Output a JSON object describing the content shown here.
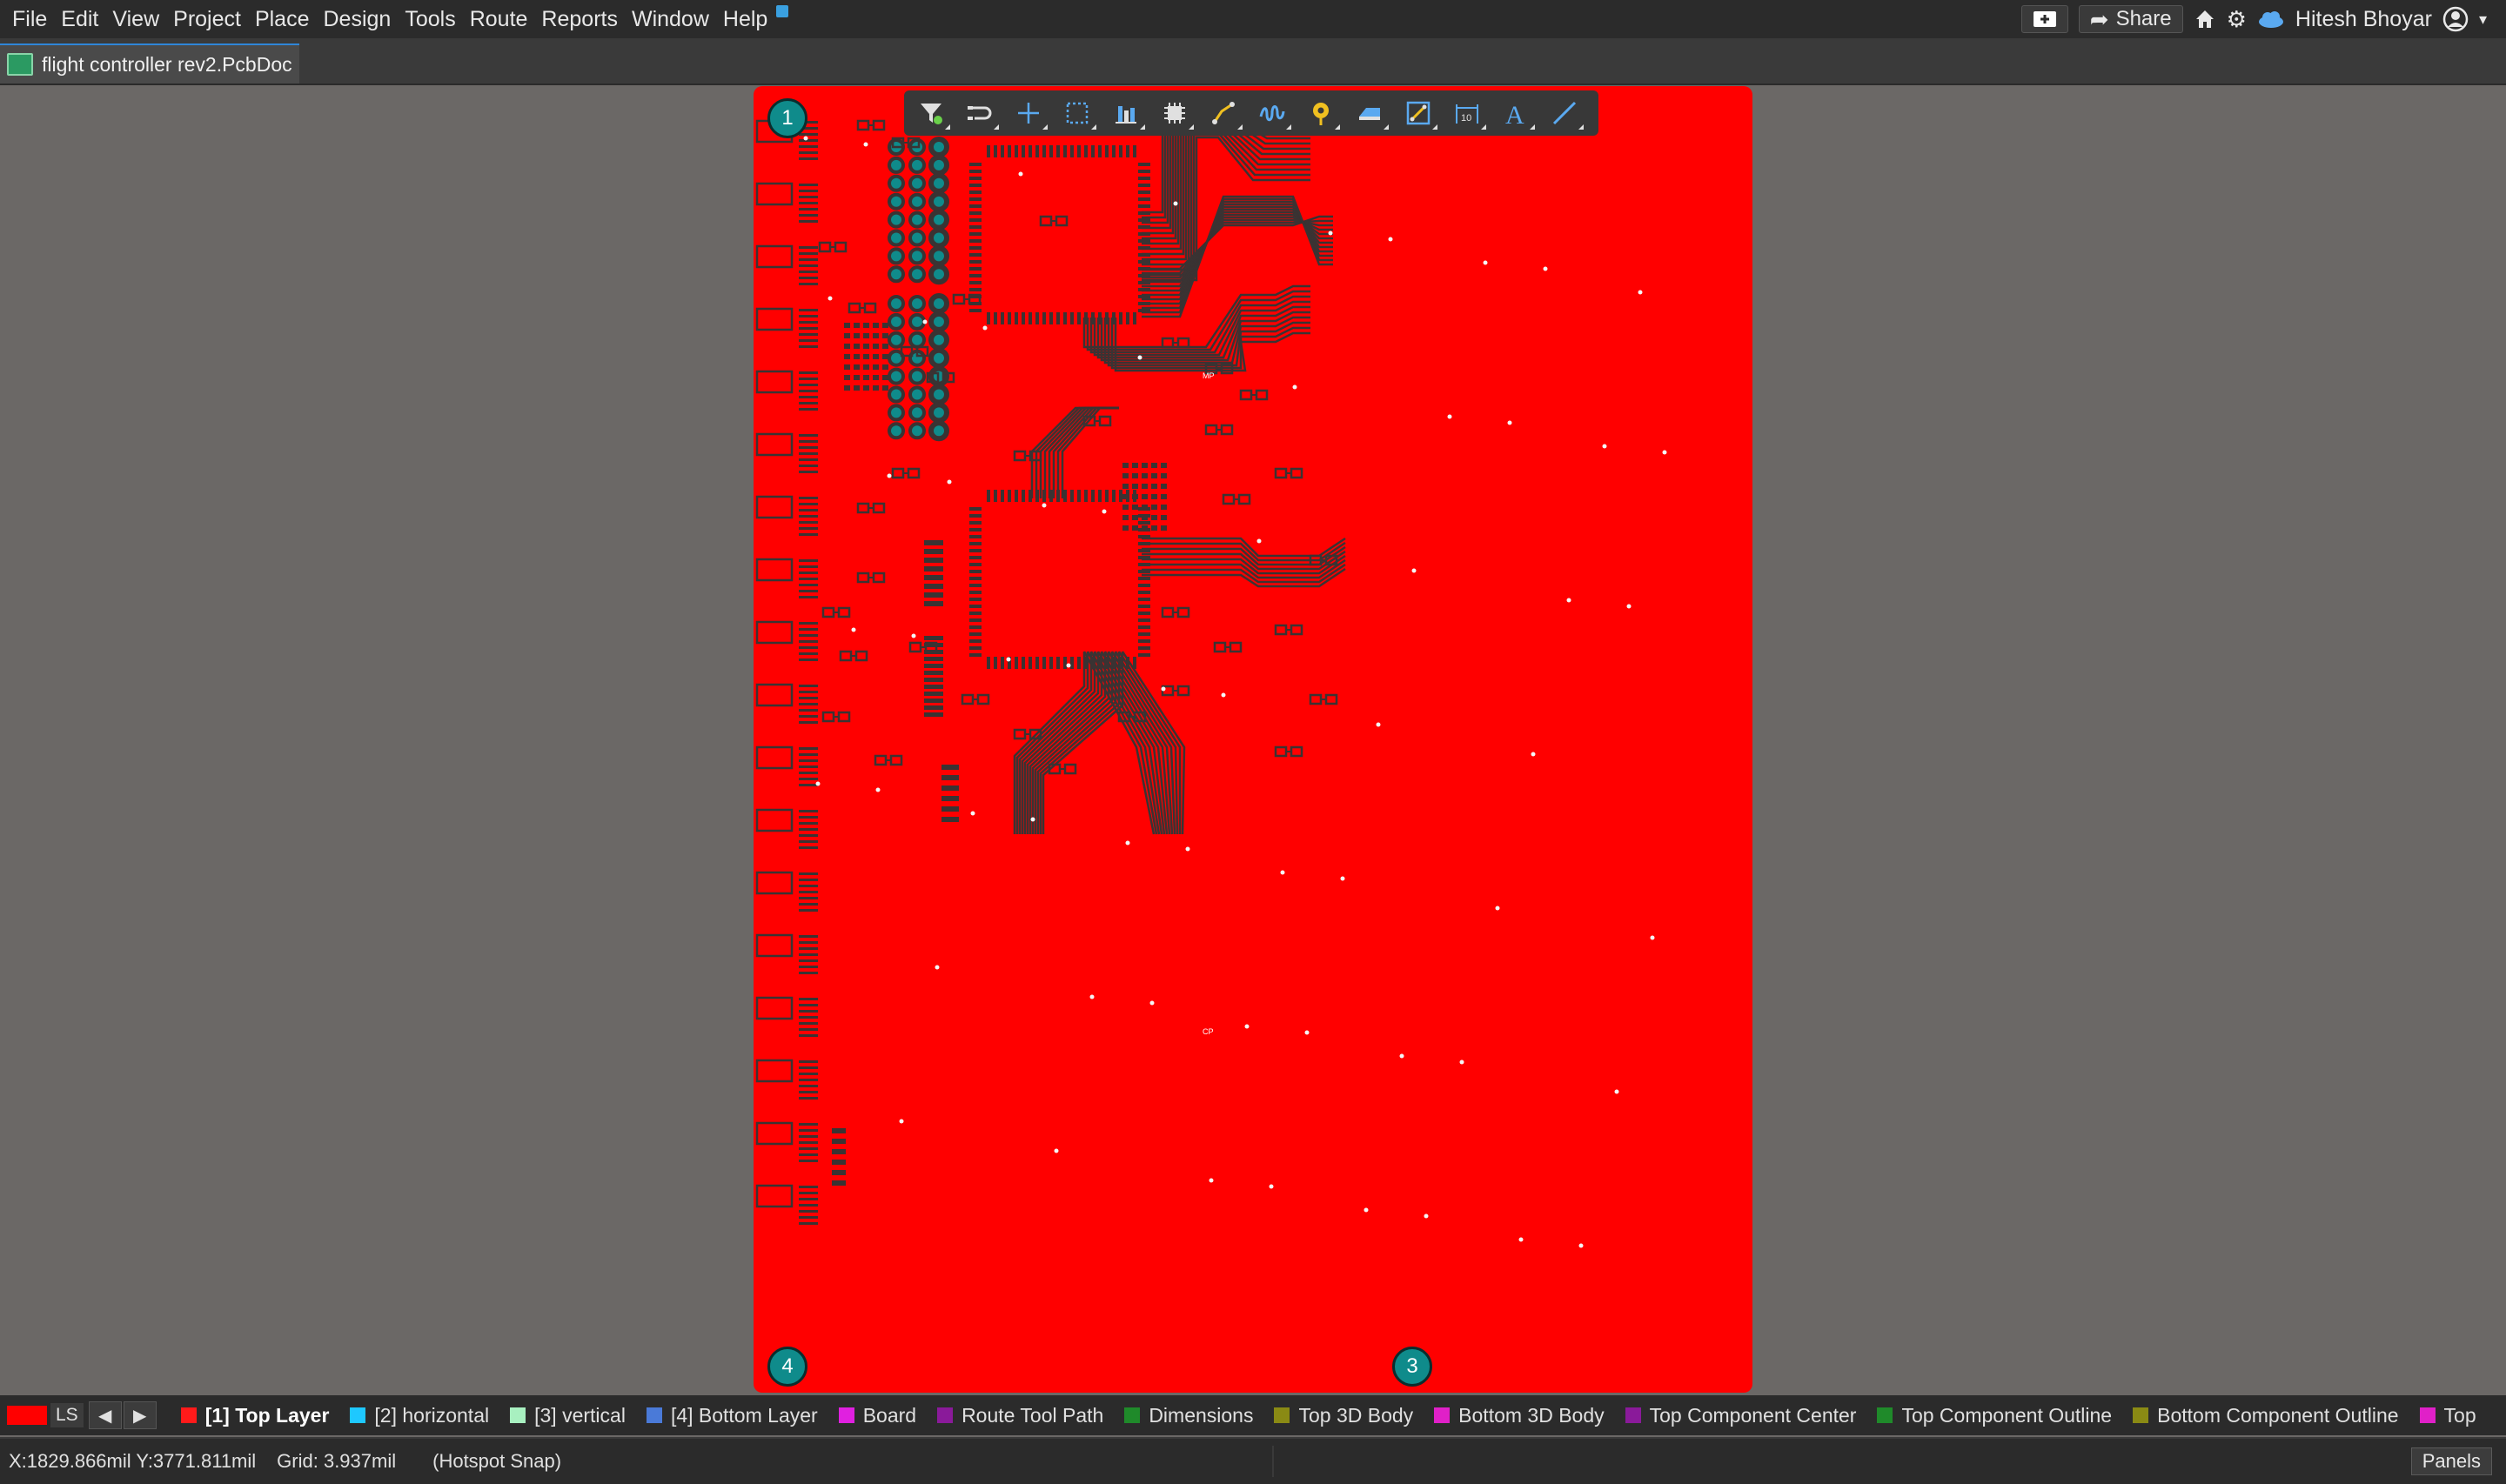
{
  "menubar": {
    "items": [
      "File",
      "Edit",
      "View",
      "Project",
      "Place",
      "Design",
      "Tools",
      "Route",
      "Reports",
      "Window",
      "Help"
    ],
    "share_label": "Share",
    "user_name": "Hitesh Bhoyar"
  },
  "document": {
    "tab_label": "flight controller rev2.PcbDoc"
  },
  "board": {
    "markers": [
      "1",
      "4",
      "3"
    ],
    "chip_labels": [
      "MP",
      "CP"
    ]
  },
  "floating_toolbar": {
    "icons": [
      "filter-icon",
      "interactive-routing-icon",
      "cross-icon",
      "select-rect-icon",
      "align-icon",
      "component-icon",
      "route-multiple-icon",
      "length-tuning-icon",
      "via-icon",
      "fill-icon",
      "pad-icon",
      "dimension-icon",
      "string-icon",
      "line-icon"
    ]
  },
  "layerbar": {
    "ls_label": "LS",
    "layers": [
      {
        "label": "[1] Top Layer",
        "color": "#ff1a1a",
        "active": true
      },
      {
        "label": "[2] horizontal",
        "color": "#1ec8ff",
        "active": false
      },
      {
        "label": "[3] vertical",
        "color": "#a8f0c0",
        "active": false
      },
      {
        "label": "[4] Bottom Layer",
        "color": "#4a7ad8",
        "active": false
      },
      {
        "label": "Board",
        "color": "#e020e0",
        "active": false
      },
      {
        "label": "Route Tool Path",
        "color": "#8a1a9a",
        "active": false
      },
      {
        "label": "Dimensions",
        "color": "#1f8a2a",
        "active": false
      },
      {
        "label": "Top 3D Body",
        "color": "#8a8a14",
        "active": false
      },
      {
        "label": "Bottom 3D Body",
        "color": "#e020c8",
        "active": false
      },
      {
        "label": "Top Component Center",
        "color": "#8a1a9a",
        "active": false
      },
      {
        "label": "Top Component Outline",
        "color": "#1f8a2a",
        "active": false
      },
      {
        "label": "Bottom Component Outline",
        "color": "#8a8a14",
        "active": false
      },
      {
        "label": "Top",
        "color": "#e020c8",
        "active": false
      }
    ]
  },
  "statusbar": {
    "coords": "X:1829.866mil Y:3771.811mil",
    "grid": "Grid: 3.937mil",
    "snap": "(Hotspot Snap)",
    "panels_label": "Panels"
  },
  "colors": {
    "board": "#ff0000",
    "trace": "#3a3333",
    "pad_teal": "#0f8b8b",
    "background": "#6b6866"
  }
}
